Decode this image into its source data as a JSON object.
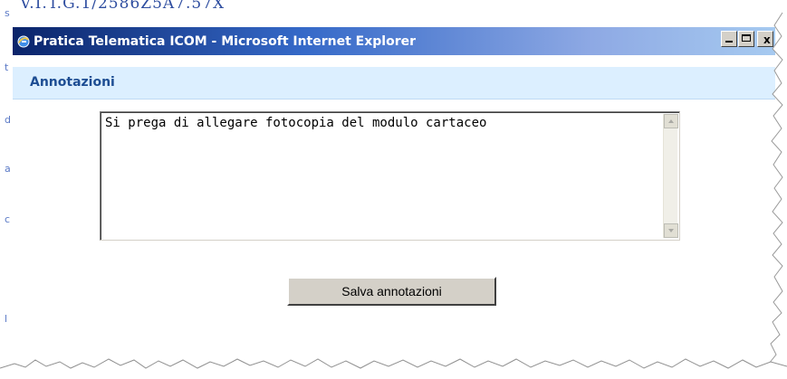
{
  "background_caption": "V.I.T.G.1/2586Z5A7.57X",
  "left_marks": [
    "s",
    "t",
    "d",
    "a",
    "c",
    "l"
  ],
  "window": {
    "title": "Pratica Telematica ICOM - Microsoft Internet Explorer",
    "controls": {
      "minimize": "_",
      "maximize": "□",
      "close": "x"
    }
  },
  "page": {
    "section_title": "Annotazioni",
    "notes": {
      "value": "Si prega di allegare fotocopia del modulo cartaceo",
      "scrollbar": {
        "up_icon": "up-arrow",
        "down_icon": "down-arrow"
      }
    },
    "save_button_label": "Salva annotazioni"
  },
  "colors": {
    "titlebar_start": "#0a246a",
    "titlebar_end": "#a6caf0",
    "section_background": "#dcefff",
    "section_title": "#1d4d93",
    "button_face": "#d4d0c8"
  }
}
